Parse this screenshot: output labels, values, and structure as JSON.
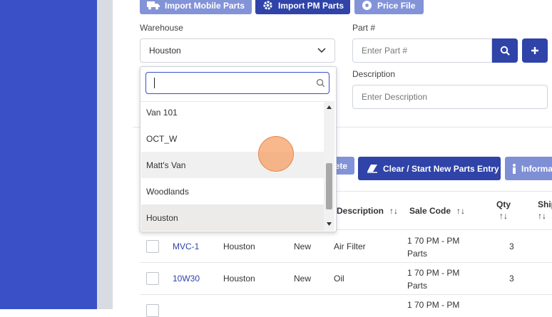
{
  "toolbar": {
    "import_mobile_parts": "Import Mobile Parts",
    "import_pm_parts": "Import PM Parts",
    "price_file": "Price File"
  },
  "form": {
    "warehouse_label": "Warehouse",
    "warehouse_value": "Houston",
    "part_label": "Part #",
    "part_placeholder": "Enter Part #",
    "description_label": "Description",
    "description_placeholder": "Enter Description"
  },
  "dropdown": {
    "search_value": "",
    "options": [
      "Van 101",
      "OCT_W",
      "Matt's Van",
      "Woodlands",
      "Houston"
    ],
    "hovered": "Matt's Van",
    "selected": "Houston"
  },
  "actions": {
    "delete_partial": "ete",
    "clear_label": "Clear / Start New Parts Entry",
    "info_partial": "Informa"
  },
  "table": {
    "headers": {
      "description": "Description",
      "sale_code": "Sale Code",
      "qty": "Qty",
      "ship_partial": "Ship"
    },
    "sort_icon": "↑↓",
    "rows": [
      {
        "part": "MVC-1",
        "warehouse": "Houston",
        "condition": "New",
        "description": "Air Filter",
        "sale_code": "1 70 PM - PM Parts",
        "qty": "3"
      },
      {
        "part": "10W30",
        "warehouse": "Houston",
        "condition": "New",
        "description": "Oil",
        "sale_code": "1 70 PM - PM Parts",
        "qty": "3"
      },
      {
        "part": "",
        "warehouse": "",
        "condition": "",
        "description": "",
        "sale_code": "1 70 PM - PM",
        "qty": ""
      }
    ]
  },
  "colors": {
    "sidebar": "#3a50c6",
    "primary_button": "#2f43a8",
    "light_button": "#7f8fd6",
    "link": "#2f43a8"
  }
}
